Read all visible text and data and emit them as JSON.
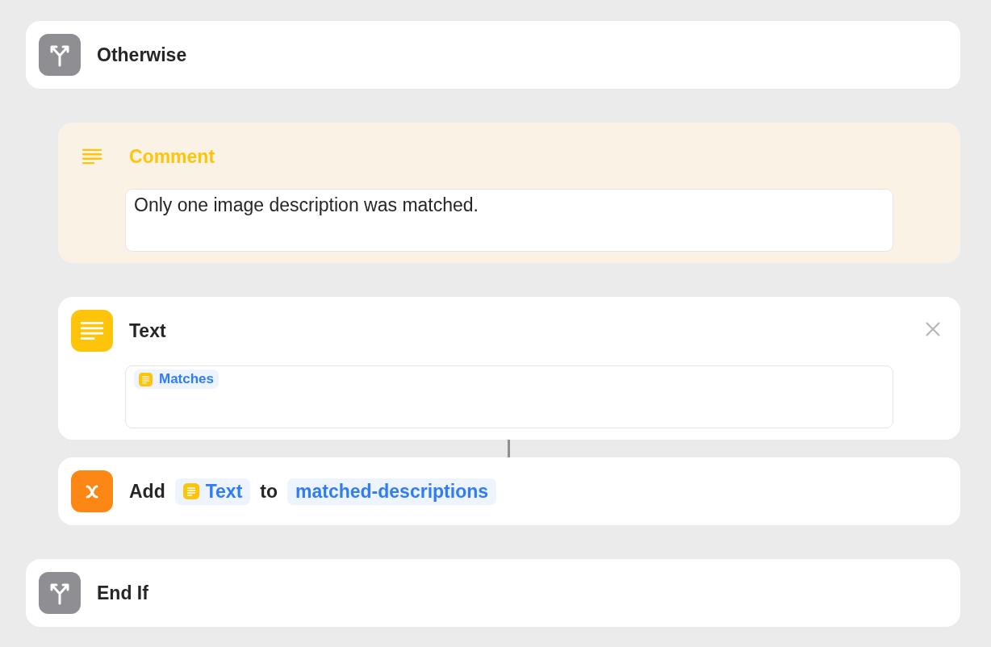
{
  "blocks": [
    {
      "kind": "control",
      "title": "Otherwise",
      "nested": false
    },
    {
      "kind": "comment",
      "title": "Comment",
      "nested": true,
      "value": "Only one image description was matched."
    },
    {
      "kind": "text",
      "title": "Text",
      "nested": true,
      "closable": true,
      "tokens": [
        {
          "label": "Matches",
          "icon": true
        }
      ]
    },
    {
      "kind": "variable",
      "nested": true,
      "parts": [
        {
          "kind": "word",
          "text": "Add"
        },
        {
          "kind": "token",
          "text": "Text",
          "icon": true
        },
        {
          "kind": "word",
          "text": "to"
        },
        {
          "kind": "token",
          "text": "matched-descriptions",
          "icon": false
        }
      ]
    },
    {
      "kind": "control",
      "title": "End If",
      "nested": false
    }
  ]
}
